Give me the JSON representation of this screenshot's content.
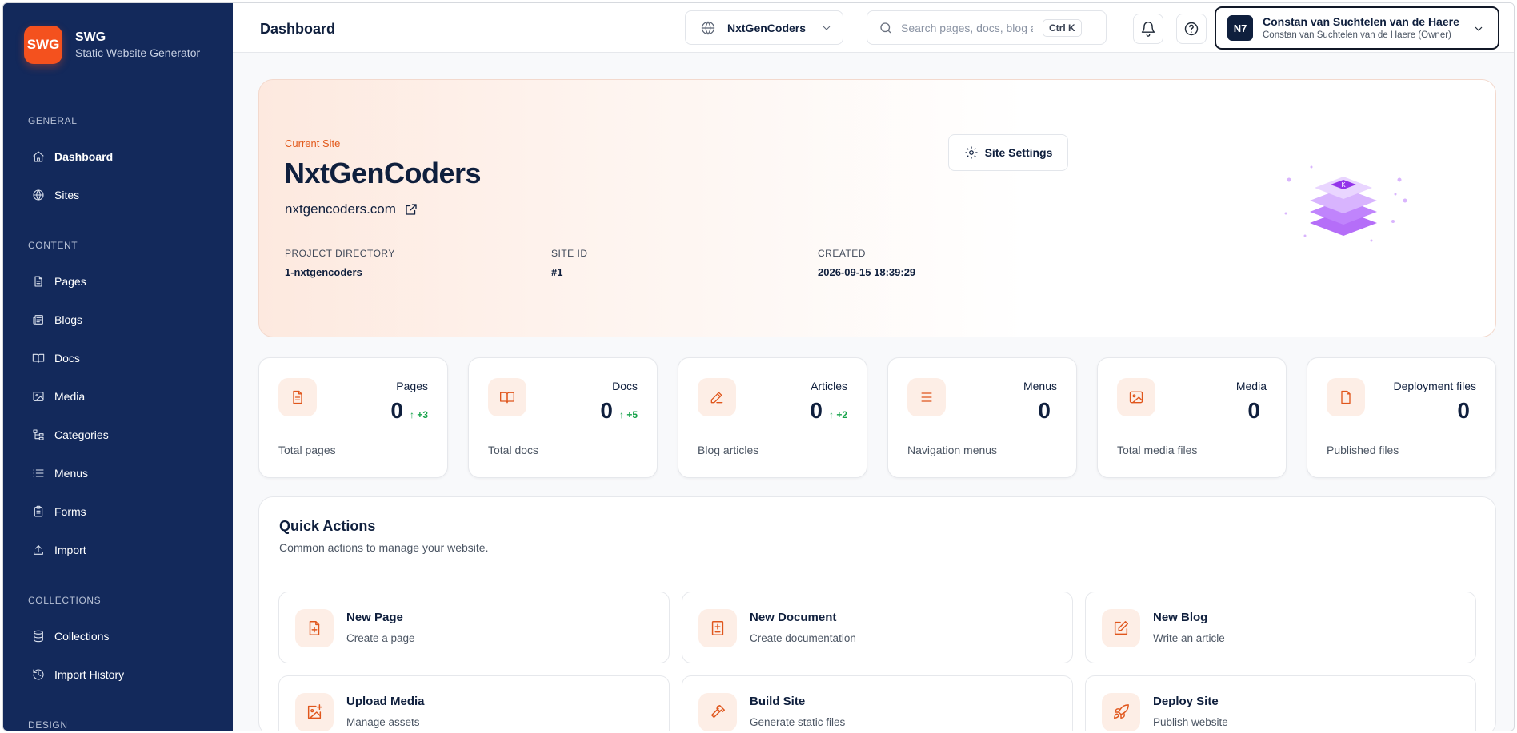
{
  "brand": {
    "logo": "SWG",
    "name": "SWG",
    "subtitle": "Static Website Generator"
  },
  "sidebar": {
    "sections": {
      "general": "GENERAL",
      "content": "CONTENT",
      "collections": "COLLECTIONS",
      "design": "DESIGN"
    },
    "items": [
      {
        "label": "Dashboard",
        "icon": "home-icon"
      },
      {
        "label": "Sites",
        "icon": "globe-icon"
      },
      {
        "label": "Pages",
        "icon": "file-text-icon"
      },
      {
        "label": "Blogs",
        "icon": "newspaper-icon"
      },
      {
        "label": "Docs",
        "icon": "book-open-icon"
      },
      {
        "label": "Media",
        "icon": "image-icon"
      },
      {
        "label": "Categories",
        "icon": "tree-icon"
      },
      {
        "label": "Menus",
        "icon": "list-icon"
      },
      {
        "label": "Forms",
        "icon": "clipboard-icon"
      },
      {
        "label": "Import",
        "icon": "upload-icon"
      },
      {
        "label": "Collections",
        "icon": "database-icon"
      },
      {
        "label": "Import History",
        "icon": "history-icon"
      }
    ]
  },
  "header": {
    "title": "Dashboard",
    "site_select": "NxtGenCoders",
    "search_placeholder": "Search pages, docs, blog a",
    "search_shortcut": "Ctrl K",
    "user": {
      "avatar": "N7",
      "name": "Constan van Suchtelen van de Haere",
      "role": "Constan van Suchtelen van de Haere (Owner)"
    }
  },
  "hero": {
    "label": "Current Site",
    "title": "NxtGenCoders",
    "domain": "nxtgencoders.com",
    "settings_label": "Site Settings",
    "meta": [
      {
        "label": "PROJECT DIRECTORY",
        "value": "1-nxtgencoders"
      },
      {
        "label": "SITE ID",
        "value": "#1"
      },
      {
        "label": "CREATED",
        "value": "2026-09-15 18:39:29"
      }
    ],
    "art_badge": "K"
  },
  "stats": [
    {
      "title": "Pages",
      "value": "0",
      "delta": "↑ +3",
      "caption": "Total pages",
      "icon": "file-text-icon"
    },
    {
      "title": "Docs",
      "value": "0",
      "delta": "↑ +5",
      "caption": "Total docs",
      "icon": "book-open-icon"
    },
    {
      "title": "Articles",
      "value": "0",
      "delta": "↑ +2",
      "caption": "Blog articles",
      "icon": "pen-icon"
    },
    {
      "title": "Menus",
      "value": "0",
      "delta": "",
      "caption": "Navigation menus",
      "icon": "list-icon"
    },
    {
      "title": "Media",
      "value": "0",
      "delta": "",
      "caption": "Total media files",
      "icon": "image-icon"
    },
    {
      "title": "Deployment files",
      "value": "0",
      "delta": "",
      "caption": "Published files",
      "icon": "file-icon"
    }
  ],
  "quick_actions": {
    "title": "Quick Actions",
    "subtitle": "Common actions to manage your website.",
    "items": [
      {
        "name": "New Page",
        "desc": "Create a page",
        "icon": "file-plus-icon"
      },
      {
        "name": "New Document",
        "desc": "Create documentation",
        "icon": "file-diff-icon"
      },
      {
        "name": "New Blog",
        "desc": "Write an article",
        "icon": "edit-icon"
      },
      {
        "name": "Upload Media",
        "desc": "Manage assets",
        "icon": "image-plus-icon"
      },
      {
        "name": "Build Site",
        "desc": "Generate static files",
        "icon": "hammer-icon"
      },
      {
        "name": "Deploy Site",
        "desc": "Publish website",
        "icon": "rocket-icon"
      }
    ]
  },
  "colors": {
    "sidebar": "#13295b",
    "accent": "#f4511e",
    "success": "#16a34a"
  }
}
